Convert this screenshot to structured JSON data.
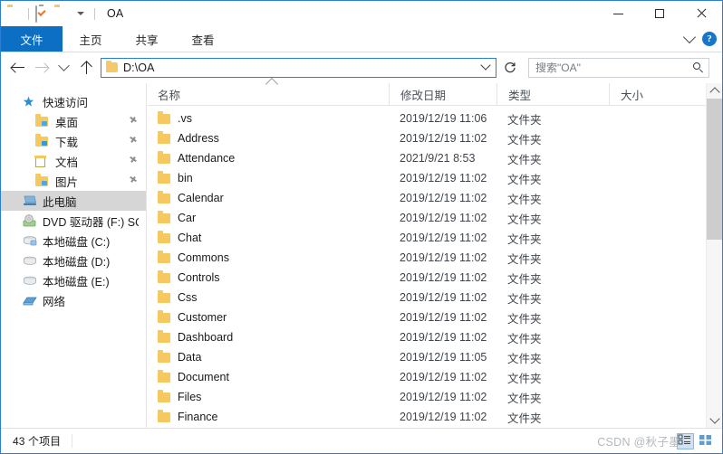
{
  "window": {
    "title": "OA",
    "quick_access": [
      {
        "name": "folder-icon",
        "label": ""
      },
      {
        "name": "properties-icon",
        "label": ""
      },
      {
        "name": "new-folder-icon",
        "label": ""
      },
      {
        "name": "customize-qat-dropdown",
        "label": ""
      }
    ],
    "controls": {
      "minimize": "─",
      "maximize": "□",
      "close": "✕"
    }
  },
  "ribbon": {
    "tabs": [
      {
        "label": "文件",
        "active": true
      },
      {
        "label": "主页",
        "active": false
      },
      {
        "label": "共享",
        "active": false
      },
      {
        "label": "查看",
        "active": false
      }
    ],
    "expand_label": "",
    "help_label": "?"
  },
  "navbar": {
    "back": "back-arrow",
    "forward": "forward-arrow",
    "recent": "recent-locations",
    "up": "up-arrow",
    "address_value": "D:\\OA",
    "refresh": "refresh-icon",
    "search_placeholder": "搜索\"OA\""
  },
  "sidebar": {
    "items": [
      {
        "label": "快速访问",
        "icon": "star-icon",
        "level": 0,
        "selected": false,
        "pinned": false
      },
      {
        "label": "桌面",
        "icon": "folder-desktop-icon",
        "level": 1,
        "selected": false,
        "pinned": true
      },
      {
        "label": "下载",
        "icon": "folder-downloads-icon",
        "level": 1,
        "selected": false,
        "pinned": true
      },
      {
        "label": "文档",
        "icon": "folder-documents-icon",
        "level": 1,
        "selected": false,
        "pinned": true
      },
      {
        "label": "图片",
        "icon": "folder-pictures-icon",
        "level": 1,
        "selected": false,
        "pinned": true
      },
      {
        "label": "此电脑",
        "icon": "this-pc-icon",
        "level": 0,
        "selected": true,
        "pinned": false
      },
      {
        "label": "DVD 驱动器 (F:) SQL",
        "icon": "dvd-drive-icon",
        "level": 0,
        "selected": false,
        "pinned": false
      },
      {
        "label": "本地磁盘 (C:)",
        "icon": "system-disk-icon",
        "level": 0,
        "selected": false,
        "pinned": false
      },
      {
        "label": "本地磁盘 (D:)",
        "icon": "local-disk-icon",
        "level": 0,
        "selected": false,
        "pinned": false
      },
      {
        "label": "本地磁盘 (E:)",
        "icon": "local-disk-icon",
        "level": 0,
        "selected": false,
        "pinned": false
      },
      {
        "label": "网络",
        "icon": "network-icon",
        "level": 0,
        "selected": false,
        "pinned": false
      }
    ]
  },
  "filelist": {
    "columns": [
      {
        "label": "名称",
        "sorted": true
      },
      {
        "label": "修改日期",
        "sorted": false
      },
      {
        "label": "类型",
        "sorted": false
      },
      {
        "label": "大小",
        "sorted": false
      }
    ],
    "rows": [
      {
        "name": ".vs",
        "date": "2019/12/19 11:06",
        "type": "文件夹",
        "size": ""
      },
      {
        "name": "Address",
        "date": "2019/12/19 11:02",
        "type": "文件夹",
        "size": ""
      },
      {
        "name": "Attendance",
        "date": "2021/9/21 8:53",
        "type": "文件夹",
        "size": ""
      },
      {
        "name": "bin",
        "date": "2019/12/19 11:02",
        "type": "文件夹",
        "size": ""
      },
      {
        "name": "Calendar",
        "date": "2019/12/19 11:02",
        "type": "文件夹",
        "size": ""
      },
      {
        "name": "Car",
        "date": "2019/12/19 11:02",
        "type": "文件夹",
        "size": ""
      },
      {
        "name": "Chat",
        "date": "2019/12/19 11:02",
        "type": "文件夹",
        "size": ""
      },
      {
        "name": "Commons",
        "date": "2019/12/19 11:02",
        "type": "文件夹",
        "size": ""
      },
      {
        "name": "Controls",
        "date": "2019/12/19 11:02",
        "type": "文件夹",
        "size": ""
      },
      {
        "name": "Css",
        "date": "2019/12/19 11:02",
        "type": "文件夹",
        "size": ""
      },
      {
        "name": "Customer",
        "date": "2019/12/19 11:02",
        "type": "文件夹",
        "size": ""
      },
      {
        "name": "Dashboard",
        "date": "2019/12/19 11:02",
        "type": "文件夹",
        "size": ""
      },
      {
        "name": "Data",
        "date": "2019/12/19 11:05",
        "type": "文件夹",
        "size": ""
      },
      {
        "name": "Document",
        "date": "2019/12/19 11:02",
        "type": "文件夹",
        "size": ""
      },
      {
        "name": "Files",
        "date": "2019/12/19 11:02",
        "type": "文件夹",
        "size": ""
      },
      {
        "name": "Finance",
        "date": "2019/12/19 11:02",
        "type": "文件夹",
        "size": ""
      }
    ]
  },
  "statusbar": {
    "item_count": "43 个项目",
    "view_details": "details-view",
    "view_large_icons": "large-icons-view"
  },
  "watermark": {
    "text": "CSDN @秋子墨"
  },
  "colors": {
    "accent": "#0d6fc4",
    "border": "#2a7fd4",
    "folder": "#f6c960",
    "selection": "#d6d6d6"
  }
}
